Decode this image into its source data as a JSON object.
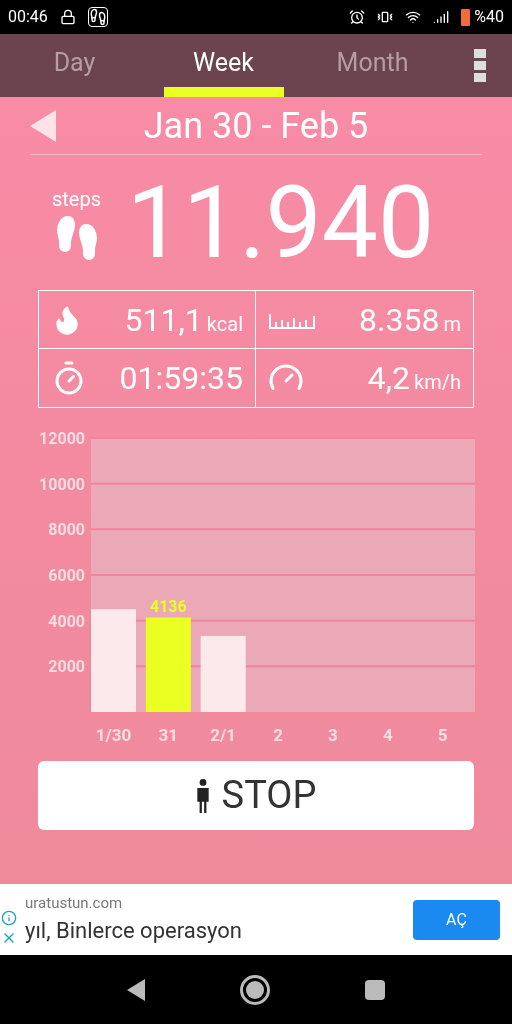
{
  "status_bar": {
    "time": "00:46",
    "battery": "%40"
  },
  "tabs": [
    {
      "label": "Day",
      "selected": false
    },
    {
      "label": "Week",
      "selected": true
    },
    {
      "label": "Month",
      "selected": false
    }
  ],
  "period": {
    "title": "Jan 30 - Feb 5"
  },
  "steps": {
    "label": "steps",
    "value": "11.940"
  },
  "stats": [
    {
      "kind": "calories",
      "value": "511,1",
      "unit": "kcal"
    },
    {
      "kind": "distance",
      "value": "8.358",
      "unit": "m"
    },
    {
      "kind": "duration",
      "value": "01:59:35"
    },
    {
      "kind": "speed",
      "value": "4,2",
      "unit": "km/h"
    }
  ],
  "chart_data": {
    "type": "bar",
    "categories": [
      "1/30",
      "31",
      "2/1",
      "2",
      "3",
      "4",
      "5"
    ],
    "series": [
      {
        "color": "#fbe9ec",
        "values": [
          4500,
          null,
          3330,
          null,
          null,
          null,
          null
        ]
      },
      {
        "color": "#eaff22",
        "values": [
          null,
          4136,
          null,
          null,
          null,
          null,
          null
        ]
      }
    ],
    "grid": true,
    "ylim": [
      0,
      12000
    ],
    "yticks": [
      2000,
      4000,
      6000,
      8000,
      10000,
      12000
    ],
    "value_labels": [
      null,
      "4136",
      null,
      null,
      null,
      null,
      null
    ]
  },
  "stop_button": {
    "label": "STOP"
  },
  "ad": {
    "domain": "uratustun.com",
    "headline": "yıl, Binlerce operasyon",
    "button": "AÇ"
  }
}
